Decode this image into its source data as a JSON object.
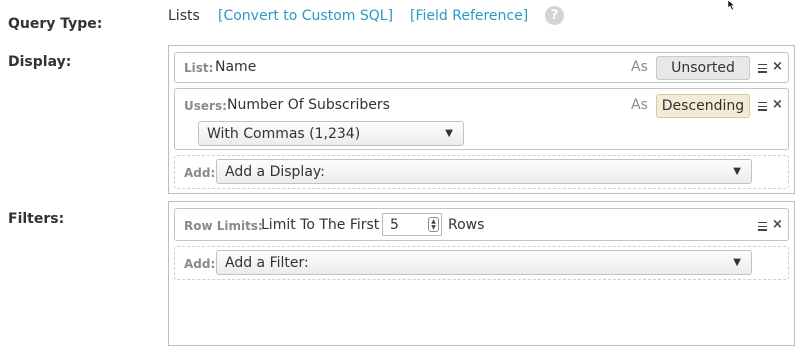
{
  "query_type": {
    "label": "Query Type:",
    "value": "Lists",
    "convert_link": "[Convert to Custom SQL]",
    "field_reference_link": "[Field Reference]",
    "help_glyph": "?"
  },
  "display": {
    "label": "Display:",
    "rows": [
      {
        "source": "List:",
        "field": "Name",
        "as_label": "As",
        "sort": "Unsorted"
      },
      {
        "source": "Users:",
        "field": "Number Of Subscribers",
        "as_label": "As",
        "sort": "Descending",
        "format": "With Commas (1,234)"
      }
    ],
    "add_label": "Add:",
    "add_select": "Add a Display:"
  },
  "filters": {
    "label": "Filters:",
    "row_limits": {
      "source": "Row Limits:",
      "prefix": "Limit To The First",
      "value": "5",
      "suffix": "Rows"
    },
    "add_label": "Add:",
    "add_select": "Add a Filter:"
  },
  "icons": {
    "menu": "hamburger-icon",
    "close": "close-icon",
    "close_glyph": "×",
    "dropdown_glyph": "▼",
    "spinner_up": "▲",
    "spinner_down": "▼"
  }
}
